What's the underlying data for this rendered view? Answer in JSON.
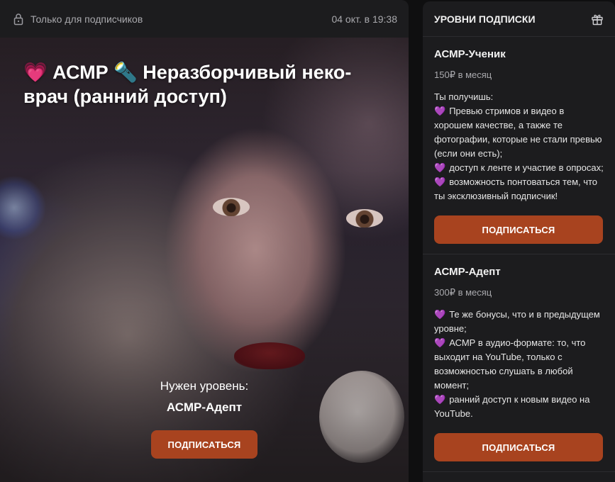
{
  "post": {
    "access_label": "Только для подписчиков",
    "date": "04 окт. в 19:38",
    "title_emoji_1": "💗",
    "title_text_1": "АСМР",
    "title_emoji_2": "🔦",
    "title_text_2": "Неразборчивый неко-врач (ранний доступ)",
    "required_label": "Нужен уровень:",
    "required_tier": "АСМР-Адепт",
    "subscribe_label": "ПОДПИСАТЬСЯ"
  },
  "tiers": {
    "header": "УРОВНИ ПОДПИСКИ",
    "items": [
      {
        "name": "АСМР-Ученик",
        "price": "150₽ в месяц",
        "intro": "Ты получишь:",
        "perks": [
          "Превью стримов и видео в хорошем качестве, а также те фотографии, которые не стали превью (если они есть);",
          "доступ к ленте и участие в опросах;",
          "возможность понтоваться тем, что ты эксклюзивный подписчик!"
        ],
        "button": "ПОДПИСАТЬСЯ"
      },
      {
        "name": "АСМР-Адепт",
        "price": "300₽ в месяц",
        "perks": [
          "Те же бонусы, что и в предыдущем уровне;",
          "АСМР в аудио-формате: то, что выходит на YouTube, только с возможностью слушать в любой момент;",
          "ранний доступ к новым видео на YouTube."
        ],
        "button": "ПОДПИСАТЬСЯ"
      }
    ]
  },
  "icons": {
    "heart_glyph": "💜",
    "lock": "lock-icon",
    "gift": "gift-icon"
  },
  "colors": {
    "accent_button": "#a8431f",
    "panel_bg": "#1c1c1e",
    "page_bg": "#0f0f10",
    "perk_heart": "#9b6ad6"
  }
}
